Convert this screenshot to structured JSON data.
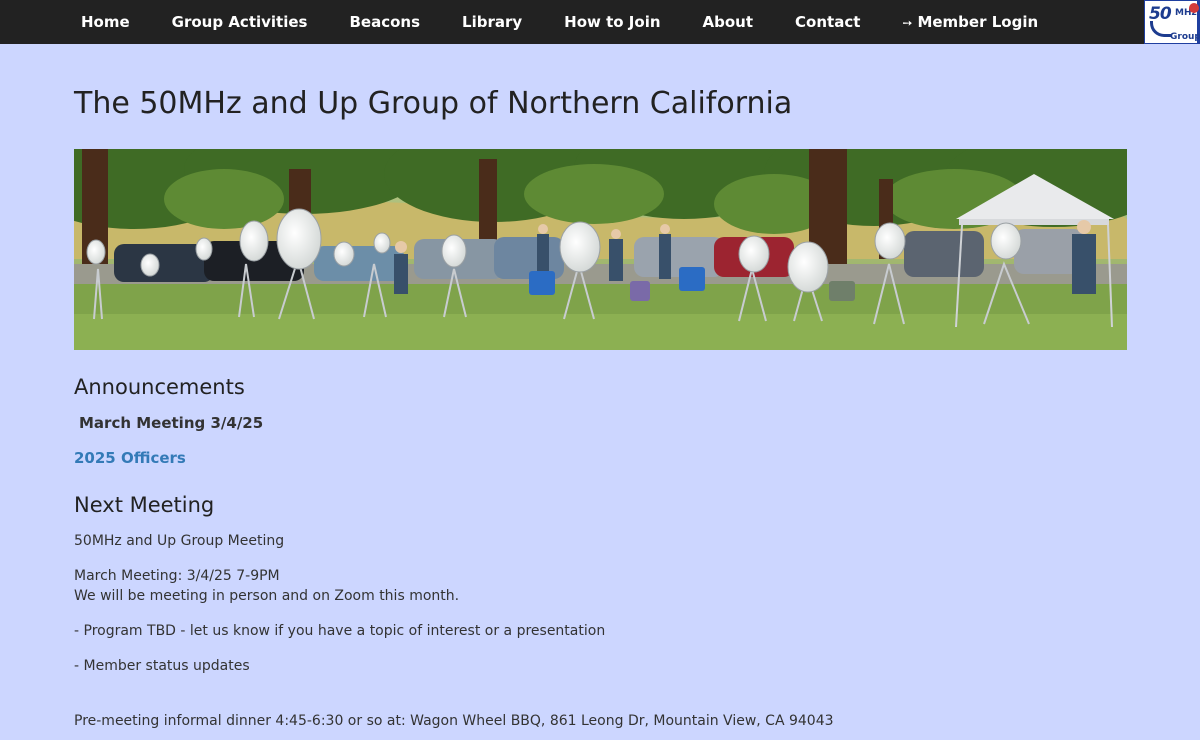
{
  "nav": {
    "items": [
      {
        "label": "Home"
      },
      {
        "label": "Group Activities"
      },
      {
        "label": "Beacons"
      },
      {
        "label": "Library"
      },
      {
        "label": "How to Join"
      },
      {
        "label": "About"
      },
      {
        "label": "Contact"
      }
    ],
    "login": {
      "icon": "sign-in-icon",
      "glyph": "➙",
      "label": "Member Login"
    },
    "logo": {
      "line1": "50",
      "line2": "MHz",
      "line3": "Group",
      "brand_color": "#1d3c8f"
    }
  },
  "page": {
    "title": "The 50MHz and Up Group of Northern California",
    "banner_alt": "Group members with dish antennas in a park"
  },
  "announcements": {
    "heading": "Announcements",
    "items": [
      {
        "label": "March Meeting 3/4/25"
      },
      {
        "label": "2025 Officers"
      }
    ]
  },
  "next_meeting": {
    "heading": "Next Meeting",
    "name": "50MHz and Up Group Meeting",
    "date_line": "March Meeting: 3/4/25 7-9PM",
    "mode_line": "We will be meeting in person and on Zoom this month.",
    "agenda": [
      "- Program TBD - let us know if you have a topic of interest or a presentation",
      "- Member status updates"
    ],
    "dinner": "Pre-meeting informal dinner 4:45-6:30 or so at: Wagon Wheel BBQ, 861 Leong Dr, Mountain View, CA 94043"
  },
  "colors": {
    "background": "#ccd6ff",
    "navbar": "#222222",
    "link": "#337ab7"
  }
}
